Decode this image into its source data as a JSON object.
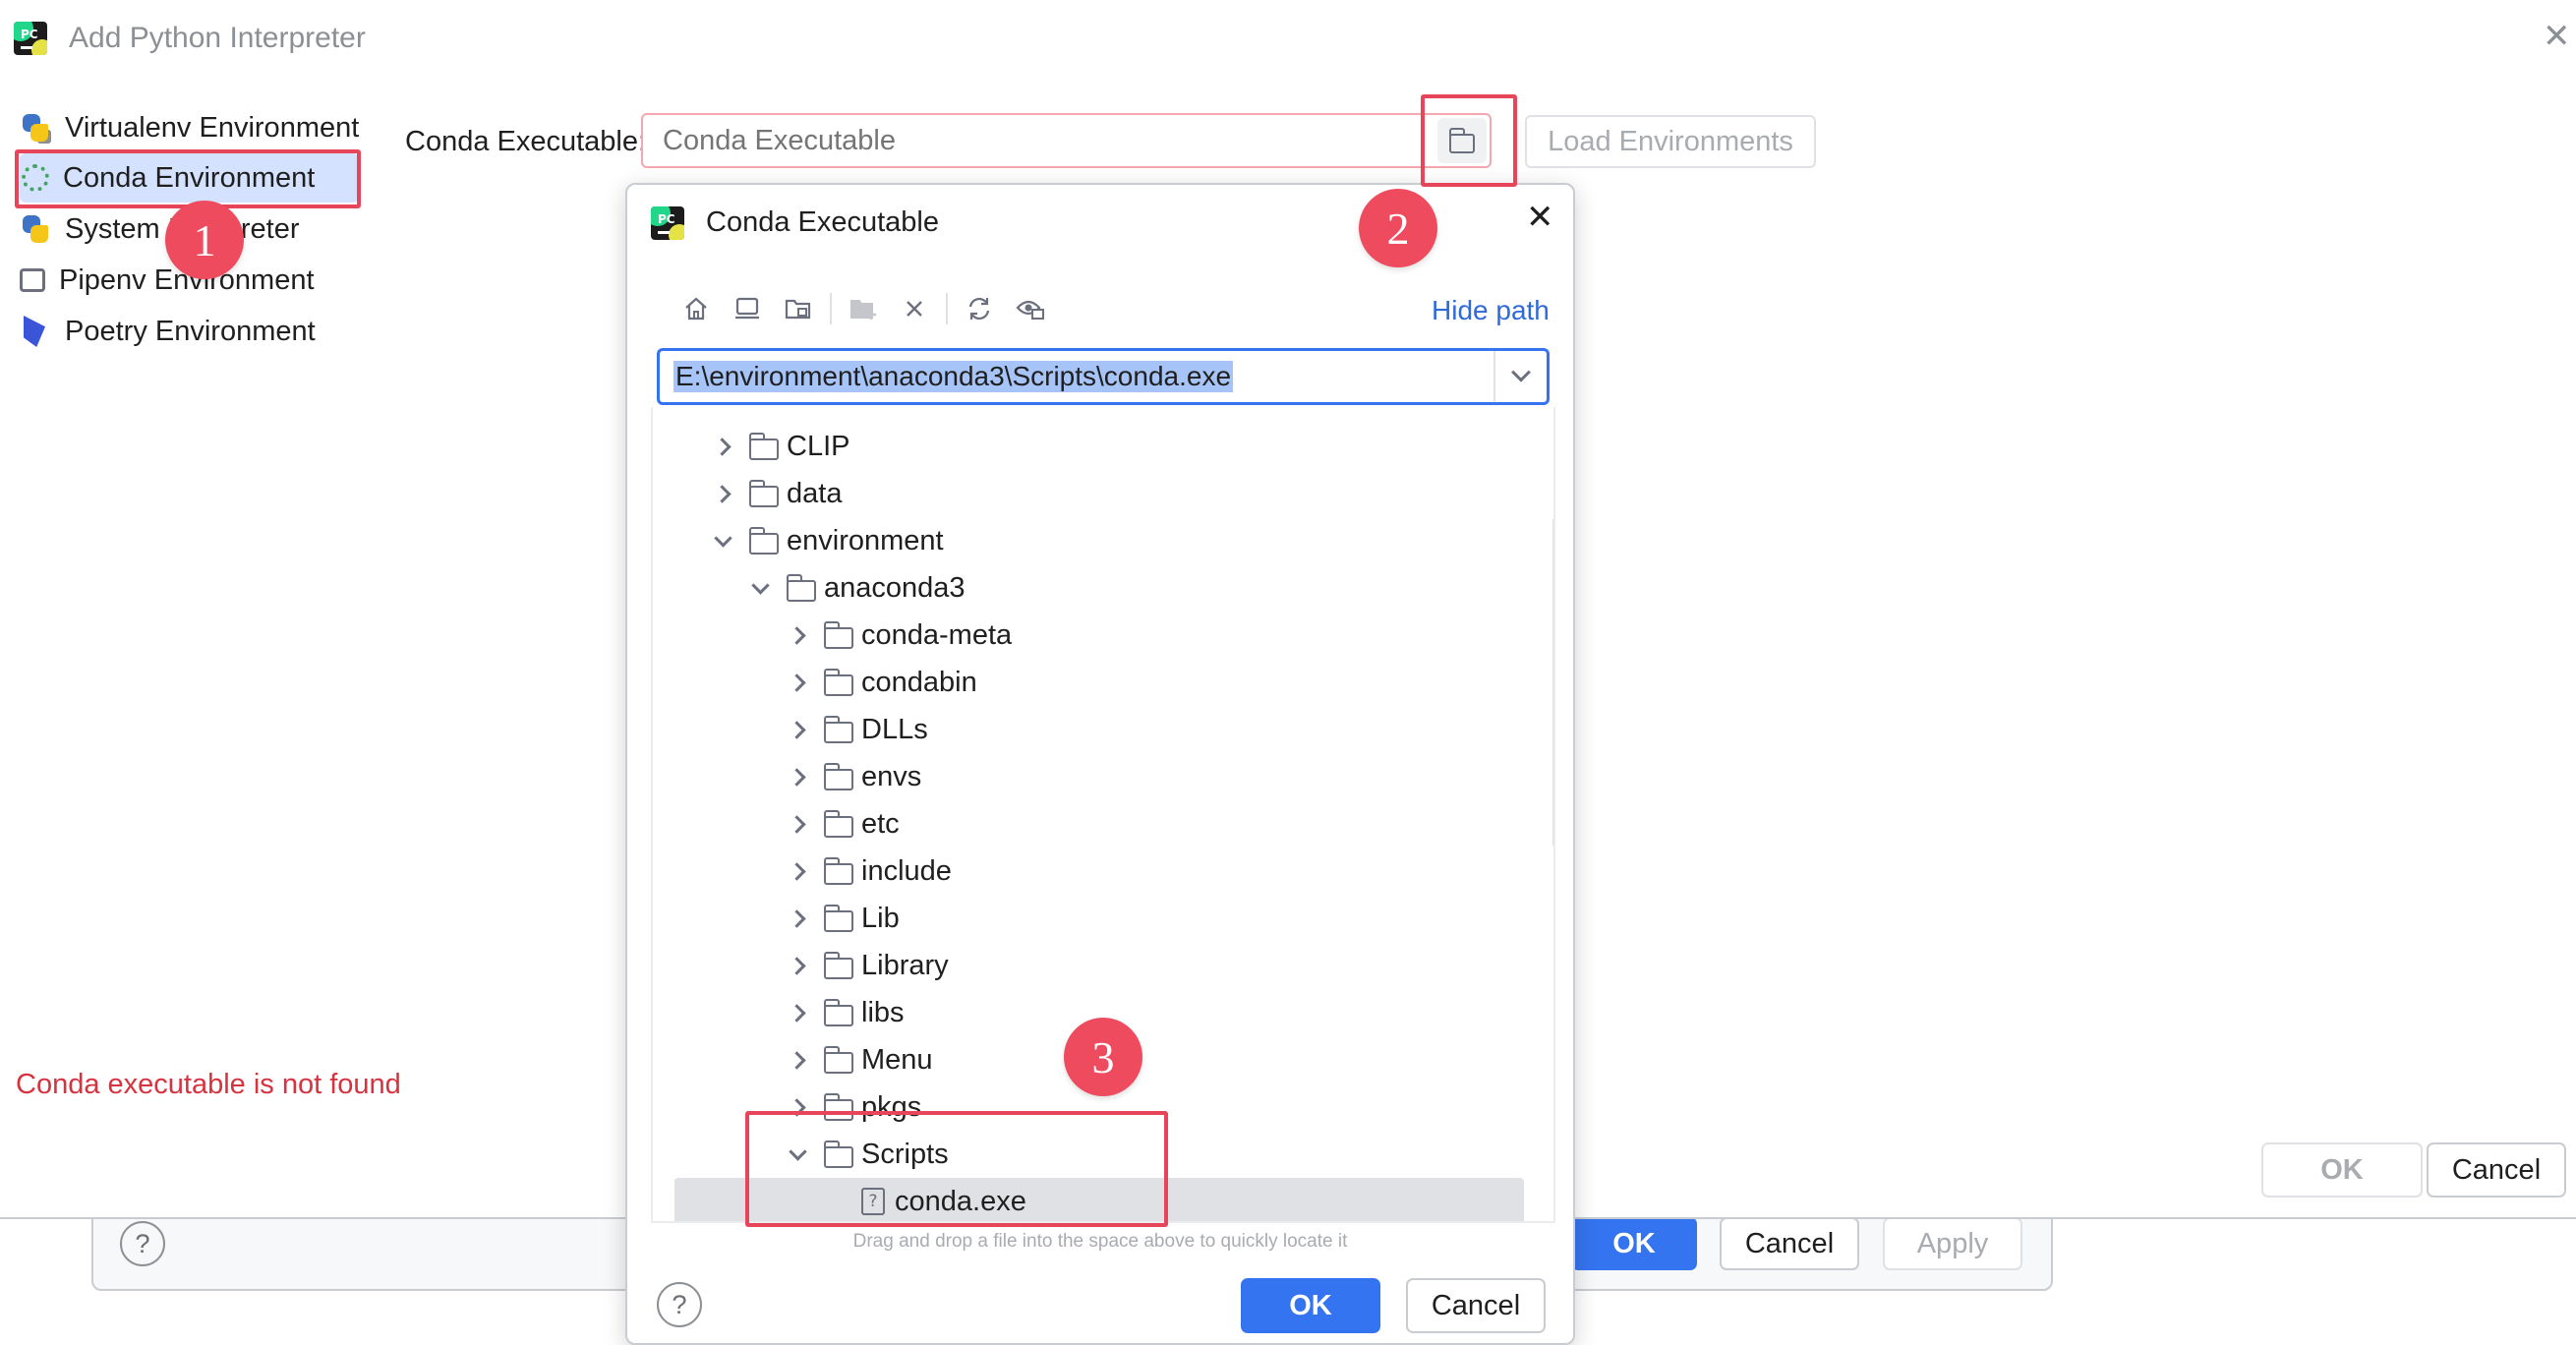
{
  "background_dialog": {
    "help": "?",
    "ok_label": "OK",
    "cancel_label": "Cancel",
    "apply_label": "Apply"
  },
  "window": {
    "title": "Add Python Interpreter",
    "close": "✕"
  },
  "sidebar": {
    "items": [
      {
        "label": "Virtualenv Environment",
        "icon": "virtualenv-icon"
      },
      {
        "label": "Conda Environment",
        "icon": "conda-icon",
        "selected": true
      },
      {
        "label": "System Interpreter",
        "icon": "python-icon"
      },
      {
        "label": "Pipenv Environment",
        "icon": "pipenv-icon"
      },
      {
        "label": "Poetry Environment",
        "icon": "poetry-icon"
      }
    ]
  },
  "form": {
    "conda_label": "Conda Executable:",
    "conda_placeholder": "Conda Executable",
    "load_environments": "Load Environments",
    "error": "Conda executable is not found",
    "ok_label": "OK",
    "cancel_label": "Cancel"
  },
  "file_dialog": {
    "title": "Conda Executable",
    "close": "✕",
    "hide_path": "Hide path",
    "path": "E:\\environment\\anaconda3\\Scripts\\conda.exe",
    "toolbar_icons": [
      "home-icon",
      "desktop-icon",
      "project-folder-icon",
      "new-folder-icon",
      "delete-icon",
      "refresh-icon",
      "show-hidden-icon"
    ],
    "tree": [
      {
        "label": "CLIP",
        "level": 0,
        "state": "collapsed",
        "type": "folder"
      },
      {
        "label": "data",
        "level": 0,
        "state": "collapsed",
        "type": "folder"
      },
      {
        "label": "environment",
        "level": 0,
        "state": "expanded",
        "type": "folder"
      },
      {
        "label": "anaconda3",
        "level": 1,
        "state": "expanded",
        "type": "folder"
      },
      {
        "label": "conda-meta",
        "level": 2,
        "state": "collapsed",
        "type": "folder"
      },
      {
        "label": "condabin",
        "level": 2,
        "state": "collapsed",
        "type": "folder"
      },
      {
        "label": "DLLs",
        "level": 2,
        "state": "collapsed",
        "type": "folder"
      },
      {
        "label": "envs",
        "level": 2,
        "state": "collapsed",
        "type": "folder"
      },
      {
        "label": "etc",
        "level": 2,
        "state": "collapsed",
        "type": "folder"
      },
      {
        "label": "include",
        "level": 2,
        "state": "collapsed",
        "type": "folder"
      },
      {
        "label": "Lib",
        "level": 2,
        "state": "collapsed",
        "type": "folder"
      },
      {
        "label": "Library",
        "level": 2,
        "state": "collapsed",
        "type": "folder"
      },
      {
        "label": "libs",
        "level": 2,
        "state": "collapsed",
        "type": "folder"
      },
      {
        "label": "Menu",
        "level": 2,
        "state": "collapsed",
        "type": "folder"
      },
      {
        "label": "pkgs",
        "level": 2,
        "state": "collapsed",
        "type": "folder"
      },
      {
        "label": "Scripts",
        "level": 2,
        "state": "expanded",
        "type": "folder"
      },
      {
        "label": "conda.exe",
        "level": 3,
        "state": "none",
        "type": "file",
        "selected": true
      }
    ],
    "drag_hint": "Drag and drop a file into the space above to quickly locate it",
    "help": "?",
    "ok_label": "OK",
    "cancel_label": "Cancel"
  },
  "annotations": {
    "step1": "1",
    "step2": "2",
    "step3": "3",
    "color": "#e6455a"
  },
  "colors": {
    "accent": "#3574f0",
    "error": "#d7333f",
    "link": "#2f6ad9",
    "selection": "#d4e2ff"
  }
}
